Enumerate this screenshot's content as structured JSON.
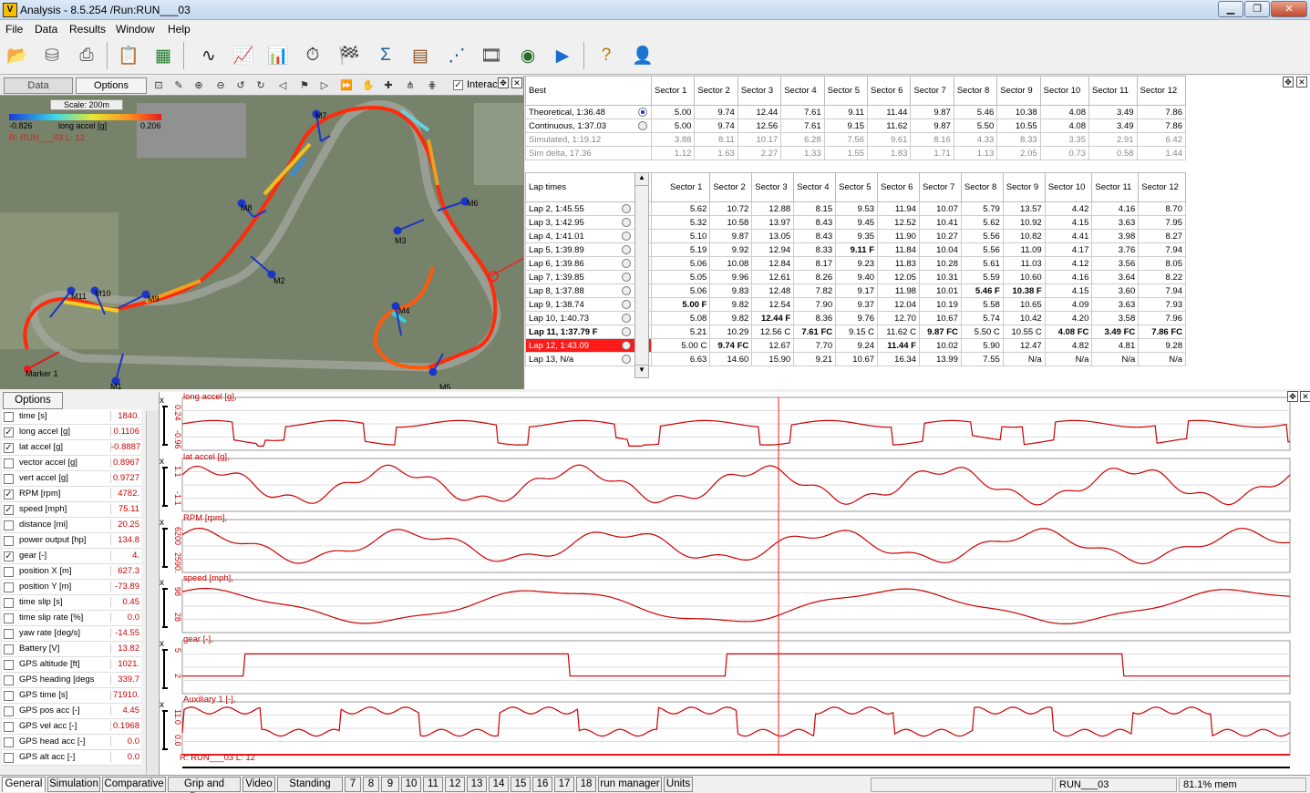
{
  "window": {
    "title": "Analysis - 8.5.254 /Run:RUN___03",
    "app_icon": "V"
  },
  "menu": [
    "File",
    "Data",
    "Results",
    "Window",
    "Help"
  ],
  "toolbar_icons": [
    "open-folder-icon",
    "database-icon",
    "print-icon",
    "clipboard-icon",
    "excel-export-icon",
    "track-map-icon",
    "line-graph-icon",
    "bar-chart-icon",
    "stopwatch-icon",
    "checkered-flag-icon",
    "sigma-math-icon",
    "spreadsheet-icon",
    "scatter-plot-icon",
    "video-icon",
    "gauge-icon",
    "play-icon",
    "help-icon",
    "support-user-icon"
  ],
  "map": {
    "tab_data": "Data",
    "tab_options": "Options",
    "interact_label": "Interact",
    "scale": "Scale: 200m",
    "legend_min": "-0.826",
    "legend_label": "long accel [g]",
    "legend_max": "0.206",
    "run_label": "R: RUN___03  L: 12",
    "marker_label": "Marker 1",
    "sector_markers": [
      "M1",
      "M2",
      "M3",
      "M4",
      "M5",
      "M6",
      "M7",
      "M8",
      "M9",
      "M10",
      "M11"
    ]
  },
  "best_table": {
    "header": "Best",
    "columns": [
      "Sector 1",
      "Sector 2",
      "Sector 3",
      "Sector 4",
      "Sector 5",
      "Sector 6",
      "Sector 7",
      "Sector 8",
      "Sector 9",
      "Sector 10",
      "Sector 11",
      "Sector 12"
    ],
    "rows": [
      {
        "label": "Theoretical, 1:36.48",
        "radio": true,
        "grey": false,
        "values": [
          "5.00",
          "9.74",
          "12.44",
          "7.61",
          "9.11",
          "11.44",
          "9.87",
          "5.46",
          "10.38",
          "4.08",
          "3.49",
          "7.86"
        ]
      },
      {
        "label": "Continuous, 1:37.03",
        "radio": true,
        "grey": false,
        "values": [
          "5.00",
          "9.74",
          "12.56",
          "7.61",
          "9.15",
          "11.62",
          "9.87",
          "5.50",
          "10.55",
          "4.08",
          "3.49",
          "7.86"
        ]
      },
      {
        "label": "Simulated, 1:19.12",
        "radio": false,
        "grey": true,
        "values": [
          "3.88",
          "8.11",
          "10.17",
          "6.28",
          "7.56",
          "9.61",
          "8.16",
          "4.33",
          "8.33",
          "3.35",
          "2.91",
          "6.42"
        ]
      },
      {
        "label": "Sim delta, 17.36",
        "radio": false,
        "grey": true,
        "values": [
          "1.12",
          "1.63",
          "2.27",
          "1.33",
          "1.55",
          "1.83",
          "1.71",
          "1.13",
          "2.05",
          "0.73",
          "0.58",
          "1.44"
        ]
      }
    ]
  },
  "lap_table": {
    "header": "Lap times",
    "columns": [
      "Sector 1",
      "Sector 2",
      "Sector 3",
      "Sector 4",
      "Sector 5",
      "Sector 6",
      "Sector 7",
      "Sector 8",
      "Sector 9",
      "Sector 10",
      "Sector 11",
      "Sector 12"
    ],
    "rows": [
      {
        "label": "Lap 2, 1:45.55",
        "values": [
          "5.62",
          "10.72",
          "12.88",
          "8.15",
          "9.53",
          "11.94",
          "10.07",
          "5.79",
          "13.57",
          "4.42",
          "4.16",
          "8.70"
        ]
      },
      {
        "label": "Lap 3, 1:42.95",
        "values": [
          "5.32",
          "10.58",
          "13.97",
          "8.43",
          "9.45",
          "12.52",
          "10.41",
          "5.62",
          "10.92",
          "4.15",
          "3.63",
          "7.95"
        ]
      },
      {
        "label": "Lap 4, 1:41.01",
        "values": [
          "5.10",
          "9.87",
          "13.05",
          "8.43",
          "9.35",
          "11.90",
          "10.27",
          "5.56",
          "10.82",
          "4.41",
          "3.98",
          "8.27"
        ]
      },
      {
        "label": "Lap 5, 1:39.89",
        "values": [
          "5.19",
          "9.92",
          "12.94",
          "8.33",
          "9.11 F",
          "11.84",
          "10.04",
          "5.56",
          "11.09",
          "4.17",
          "3.76",
          "7.94"
        ]
      },
      {
        "label": "Lap 6, 1:39.86",
        "values": [
          "5.06",
          "10.08",
          "12.84",
          "8.17",
          "9.23",
          "11.83",
          "10.28",
          "5.61",
          "11.03",
          "4.12",
          "3.56",
          "8.05"
        ]
      },
      {
        "label": "Lap 7, 1:39.85",
        "values": [
          "5.05",
          "9.96",
          "12.61",
          "8.26",
          "9.40",
          "12.05",
          "10.31",
          "5.59",
          "10.60",
          "4.16",
          "3.64",
          "8.22"
        ]
      },
      {
        "label": "Lap 8, 1:37.88",
        "values": [
          "5.06",
          "9.83",
          "12.48",
          "7.82",
          "9.17",
          "11.98",
          "10.01",
          "5.46 F",
          "10.38 F",
          "4.15",
          "3.60",
          "7.94"
        ]
      },
      {
        "label": "Lap 9, 1:38.74",
        "values": [
          "5.00 F",
          "9.82",
          "12.54",
          "7.90",
          "9.37",
          "12.04",
          "10.19",
          "5.58",
          "10.65",
          "4.09",
          "3.63",
          "7.93"
        ]
      },
      {
        "label": "Lap 10, 1:40.73",
        "values": [
          "5.08",
          "9.82",
          "12.44 F",
          "8.36",
          "9.76",
          "12.70",
          "10.67",
          "5.74",
          "10.42",
          "4.20",
          "3.58",
          "7.96"
        ]
      },
      {
        "label": "Lap 11, 1:37.79 F",
        "values": [
          "5.21",
          "10.29",
          "12.56 C",
          "7.61 FC",
          "9.15 C",
          "11.62 C",
          "9.87 FC",
          "5.50 C",
          "10.55 C",
          "4.08 FC",
          "3.49 FC",
          "7.86 FC"
        ]
      },
      {
        "label": "Lap 12, 1:43.09",
        "values": [
          "5.00 C",
          "9.74 FC",
          "12.67",
          "7.70",
          "9.24",
          "11.44 F",
          "10.02",
          "5.90",
          "12.47",
          "4.82",
          "4.81",
          "9.28"
        ]
      },
      {
        "label": "Lap 13, N/a",
        "values": [
          "6.63",
          "14.60",
          "15.90",
          "9.21",
          "10.67",
          "16.34",
          "13.99",
          "7.55",
          "N/a",
          "N/a",
          "N/a",
          "N/a"
        ]
      }
    ]
  },
  "channels": {
    "options_label": "Options",
    "items": [
      {
        "name": "time [s]",
        "value": "1840.",
        "checked": false
      },
      {
        "name": "long accel [g]",
        "value": "0.1106",
        "checked": true
      },
      {
        "name": "lat accel [g]",
        "value": "-0.8887",
        "checked": true
      },
      {
        "name": "vector accel [g]",
        "value": "0.8967",
        "checked": false
      },
      {
        "name": "vert accel [g]",
        "value": "0.9727",
        "checked": false
      },
      {
        "name": "RPM [rpm]",
        "value": "4782.",
        "checked": true
      },
      {
        "name": "speed [mph]",
        "value": "75.11",
        "checked": true
      },
      {
        "name": "distance [mi]",
        "value": "20.25",
        "checked": false
      },
      {
        "name": "power output [hp]",
        "value": "134.8",
        "checked": false
      },
      {
        "name": "gear [-]",
        "value": "4.",
        "checked": true
      },
      {
        "name": "position X [m]",
        "value": "627.3",
        "checked": false
      },
      {
        "name": "position Y [m]",
        "value": "-73.89",
        "checked": false
      },
      {
        "name": "time slip [s]",
        "value": "0.45",
        "checked": false
      },
      {
        "name": "time slip rate [%]",
        "value": "0.0",
        "checked": false
      },
      {
        "name": "yaw rate [deg/s]",
        "value": "-14.55",
        "checked": false
      },
      {
        "name": "Battery [V]",
        "value": "13.82",
        "checked": false
      },
      {
        "name": "GPS altitude [ft]",
        "value": "1021.",
        "checked": false
      },
      {
        "name": "GPS heading [degs]",
        "value": "339.7",
        "checked": false
      },
      {
        "name": "GPS time [s]",
        "value": "71910.",
        "checked": false
      },
      {
        "name": "GPS pos acc [-]",
        "value": "4.45",
        "checked": false
      },
      {
        "name": "GPS vel acc [-]",
        "value": "0.1968",
        "checked": false
      },
      {
        "name": "GPS head acc [-]",
        "value": "0.0",
        "checked": false
      },
      {
        "name": "GPS alt acc [-]",
        "value": "0.0",
        "checked": false
      }
    ]
  },
  "graphs": [
    {
      "label": "long accel [g],",
      "ticks": [
        "0.24",
        "-0.96"
      ]
    },
    {
      "label": "lat accel [g],",
      "ticks": [
        "1.1",
        "-1.1"
      ]
    },
    {
      "label": "RPM [rpm],",
      "ticks": [
        "6200",
        "2590."
      ]
    },
    {
      "label": "speed [mph],",
      "ticks": [
        "98",
        "28"
      ]
    },
    {
      "label": "gear [-],",
      "ticks": [
        "5",
        "2"
      ]
    },
    {
      "label": "Auxiliary 1 [-],",
      "ticks": [
        "11.0",
        "0.0"
      ]
    }
  ],
  "graph_footer": "R: RUN___03  L: 12",
  "bottom_tabs": [
    "General",
    "Simulation",
    "Comparative",
    "Grip and Power",
    "Video",
    "Standing start",
    "7",
    "8",
    "9",
    "10",
    "11",
    "12",
    "13",
    "14",
    "15",
    "16",
    "17",
    "18",
    "run manager",
    "Units"
  ],
  "status": {
    "run": "RUN___03",
    "memory": "81.1% mem"
  },
  "colors": {
    "trace": "#cc0000",
    "highlight": "#ff1a1a",
    "marker": "#1a35c8"
  }
}
